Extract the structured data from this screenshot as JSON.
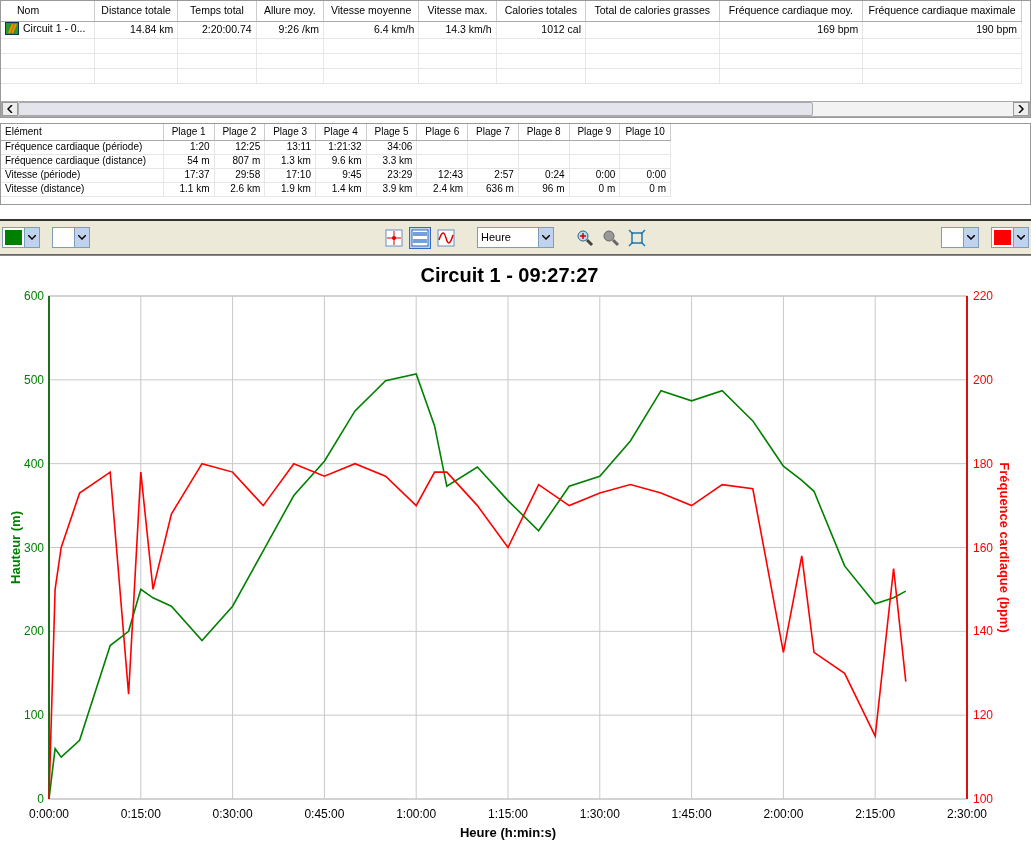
{
  "summary_table": {
    "columns": [
      "Nom",
      "Distance totale",
      "Temps total",
      "Allure moy.",
      "Vitesse moyenne",
      "Vitesse max.",
      "Calories totales",
      "Total de calories grasses",
      "Fréquence cardiaque moy.",
      "Fréquence cardiaque maximale"
    ],
    "rows": [
      {
        "cells": [
          "Circuit 1 - 0...",
          "14.84 km",
          "2:20:00.74",
          "9:26 /km",
          "6.4 km/h",
          "14.3 km/h",
          "1012 cal",
          "",
          "169 bpm",
          "190 bpm"
        ]
      }
    ]
  },
  "zones_table": {
    "columns": [
      "Elément",
      "Plage 1",
      "Plage 2",
      "Plage 3",
      "Plage 4",
      "Plage 5",
      "Plage 6",
      "Plage 7",
      "Plage 8",
      "Plage 9",
      "Plage 10"
    ],
    "rows": [
      [
        "Fréquence cardiaque (période)",
        "1:20",
        "12:25",
        "13:11",
        "1:21:32",
        "34:06",
        "",
        "",
        "",
        "",
        ""
      ],
      [
        "Fréquence cardiaque (distance)",
        "54 m",
        "807 m",
        "1.3 km",
        "9.6 km",
        "3.3 km",
        "",
        "",
        "",
        "",
        ""
      ],
      [
        "Vitesse (période)",
        "17:37",
        "29:58",
        "17:10",
        "9:45",
        "23:29",
        "12:43",
        "2:57",
        "0:24",
        "0:00",
        "0:00"
      ],
      [
        "Vitesse (distance)",
        "1.1 km",
        "2.6 km",
        "1.9 km",
        "1.4 km",
        "3.9 km",
        "2.4 km",
        "636 m",
        "96 m",
        "0 m",
        "0 m"
      ]
    ]
  },
  "toolbar": {
    "color_pickers": [
      {
        "color": "#008000"
      },
      {
        "color": "#ff0000"
      }
    ],
    "tools": [
      {
        "selected": false
      },
      {
        "selected": true
      },
      {
        "selected": false
      }
    ],
    "x_axis_select": "Heure"
  },
  "chart": {
    "chart_data": {
      "type": "line",
      "grid": true,
      "title": "Circuit 1 - 09:27:27",
      "xlabel": "Heure (h:min:s)",
      "ylabel": "Hauteur (m)",
      "y2label": "Fréquence cardiaque (bpm)",
      "x": [
        0,
        1,
        2,
        5,
        10,
        13,
        15,
        17,
        20,
        25,
        30,
        35,
        40,
        45,
        50,
        55,
        60,
        63,
        65,
        70,
        75,
        80,
        85,
        90,
        95,
        100,
        105,
        110,
        115,
        120,
        123,
        125,
        130,
        135,
        138,
        140
      ],
      "xlim": [
        0,
        150
      ],
      "ylim": [
        0,
        600
      ],
      "y2lim": [
        100,
        220
      ],
      "xticks": [
        {
          "value": 0,
          "label": "0:00:00"
        },
        {
          "value": 15,
          "label": "0:15:00"
        },
        {
          "value": 30,
          "label": "0:30:00"
        },
        {
          "value": 45,
          "label": "0:45:00"
        },
        {
          "value": 60,
          "label": "1:00:00"
        },
        {
          "value": 75,
          "label": "1:15:00"
        },
        {
          "value": 90,
          "label": "1:30:00"
        },
        {
          "value": 105,
          "label": "1:45:00"
        },
        {
          "value": 120,
          "label": "2:00:00"
        },
        {
          "value": 135,
          "label": "2:15:00"
        },
        {
          "value": 150,
          "label": "2:30:00"
        }
      ],
      "yticks": [
        0,
        100,
        200,
        300,
        400,
        500,
        600
      ],
      "y2ticks": [
        100,
        120,
        140,
        160,
        180,
        200,
        220
      ],
      "series": [
        {
          "color": "#008000",
          "values": [
            0,
            60,
            50,
            70,
            183,
            200,
            250,
            240,
            230,
            189,
            230,
            296,
            362,
            403,
            463,
            499,
            507,
            445,
            373,
            396,
            356,
            320,
            373,
            385,
            427,
            487,
            475,
            487,
            451,
            397,
            380,
            367,
            278,
            233,
            240,
            248
          ]
        },
        {
          "color": "#ff0000",
          "axis": "y2",
          "values": [
            100,
            150,
            160,
            173,
            178,
            125,
            178,
            150,
            168,
            180,
            178,
            170,
            180,
            177,
            180,
            177,
            170,
            178,
            178,
            170,
            160,
            175,
            170,
            173,
            175,
            173,
            170,
            175,
            174,
            135,
            158,
            135,
            130,
            115,
            155,
            128
          ]
        }
      ]
    }
  }
}
